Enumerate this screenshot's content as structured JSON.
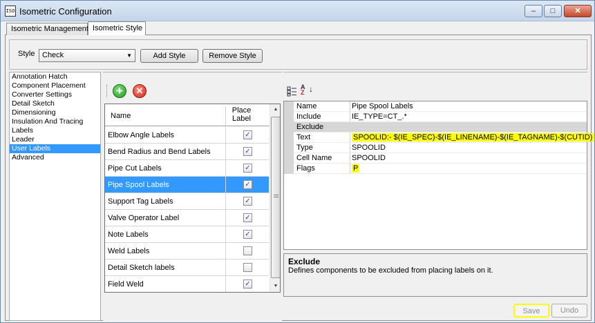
{
  "window": {
    "title": "Isometric Configuration",
    "app_icon_text": "ISO",
    "minimize_glyph": "–",
    "maximize_glyph": "□",
    "close_glyph": "✕"
  },
  "tabs": [
    {
      "label": "Isometric Management",
      "active": false
    },
    {
      "label": "Isometric Style",
      "active": true
    }
  ],
  "style_bar": {
    "label": "Style",
    "selected": "Check",
    "dropdown_glyph": "▼",
    "add_label": "Add Style",
    "remove_label": "Remove Style"
  },
  "categories": [
    "Annotation Hatch",
    "Component Placement",
    "Converter Settings",
    "Detail Sketch",
    "Dimensioning",
    "Insulation And Tracing",
    "Labels",
    "Leader",
    "User Labels",
    "Advanced"
  ],
  "selected_category": "User Labels",
  "toolbar": {
    "add_glyph": "+",
    "delete_glyph": "✕"
  },
  "labels_grid": {
    "col_name": "Name",
    "col_place": "Place Label",
    "check_glyph": "✓",
    "rows": [
      {
        "name": "Elbow Angle Labels",
        "checked": true
      },
      {
        "name": "Bend Radius and Bend Labels",
        "checked": true
      },
      {
        "name": "Pipe Cut Labels",
        "checked": true
      },
      {
        "name": "Pipe Spool Labels",
        "checked": true
      },
      {
        "name": "Support Tag Labels",
        "checked": true
      },
      {
        "name": "Valve Operator Label",
        "checked": true
      },
      {
        "name": "Note Labels",
        "checked": true
      },
      {
        "name": "Weld Labels",
        "checked": false
      },
      {
        "name": "Detail Sketch labels",
        "checked": false
      },
      {
        "name": "Field Weld",
        "checked": true
      }
    ],
    "selected_row": "Pipe Spool Labels",
    "scroll_up_glyph": "▲",
    "scroll_down_glyph": "▼"
  },
  "prop_toolbar": {
    "categorized_icon": "categorized-icon",
    "az_a": "A",
    "az_z": "Z",
    "az_arrow": "↓"
  },
  "properties": [
    {
      "name": "Name",
      "value": "Pipe Spool Labels",
      "highlight": false
    },
    {
      "name": "Include",
      "value": "IE_TYPE=CT_.*",
      "highlight": false
    },
    {
      "name": "Exclude",
      "value": "",
      "highlight": false
    },
    {
      "name": "Text",
      "value": "SPOOLID:- $(IE_SPEC)-$(IE_LINENAME)-$(IE_TAGNAME)-$(CUTID)",
      "highlight": true
    },
    {
      "name": "Type",
      "value": "SPOOLID",
      "highlight": false
    },
    {
      "name": "Cell Name",
      "value": "SPOOLID",
      "highlight": false
    },
    {
      "name": "Flags",
      "value": "P",
      "highlight": true
    }
  ],
  "selected_property": "Exclude",
  "description": {
    "title": "Exclude",
    "text": "Defines components to be excluded from placing labels on it."
  },
  "buttons": {
    "save": "Save",
    "undo": "Undo"
  },
  "colors": {
    "selection": "#3399ff",
    "highlight": "#ffff00"
  }
}
